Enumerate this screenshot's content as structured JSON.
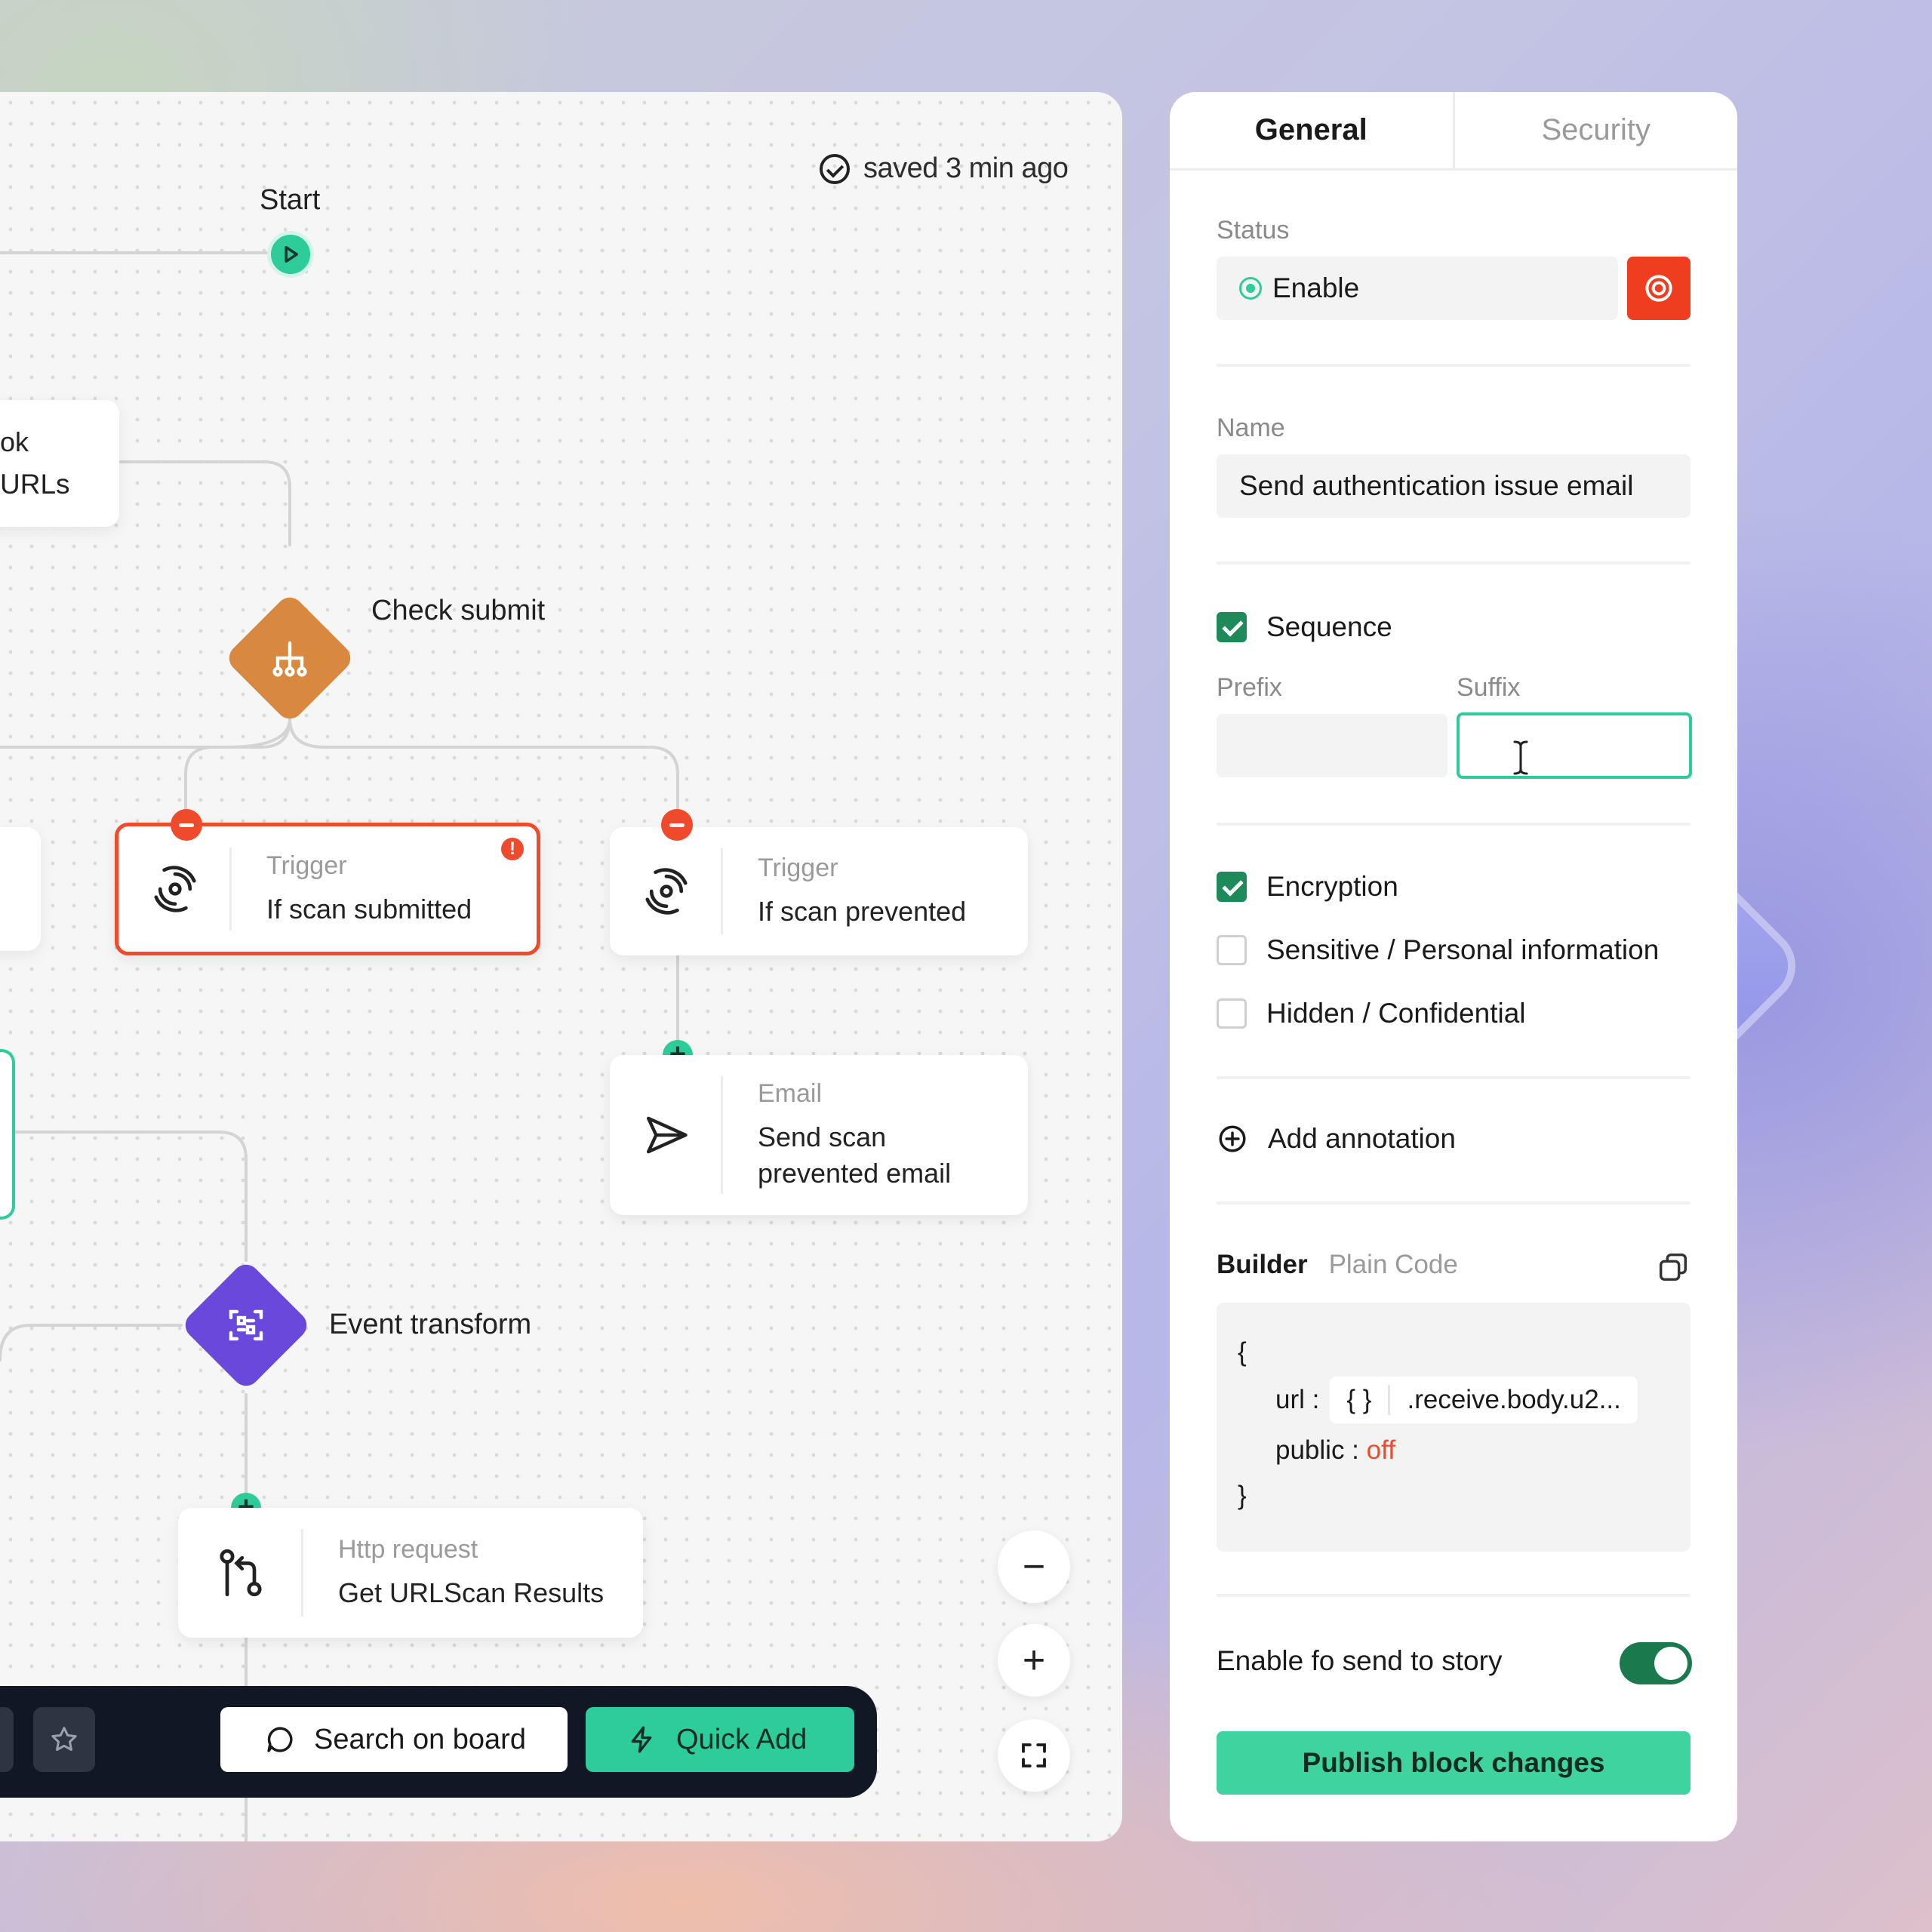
{
  "canvas": {
    "saved_status": "saved 3 min ago",
    "start_label": "Start",
    "partial_node": {
      "line1": "ok",
      "line2": "URLs"
    },
    "check_submit_label": "Check submit",
    "trigger_submitted": {
      "kind": "Trigger",
      "title": "If scan submitted"
    },
    "trigger_prevented": {
      "kind": "Trigger",
      "title": "If scan prevented"
    },
    "email_node": {
      "kind": "Email",
      "title_line1": "Send scan",
      "title_line2": "prevented email"
    },
    "event_transform_label": "Event transform",
    "http_node": {
      "kind": "Http request",
      "title": "Get URLScan Results"
    },
    "toolbar": {
      "search_label": "Search on board",
      "quick_add_label": "Quick Add"
    },
    "zoom": {
      "out": "−",
      "in": "+"
    }
  },
  "panel": {
    "tabs": [
      {
        "label": "General",
        "active": true
      },
      {
        "label": "Security",
        "active": false
      }
    ],
    "status": {
      "label": "Status",
      "value": "Enable"
    },
    "name": {
      "label": "Name",
      "value": "Send authentication issue email"
    },
    "sequence": {
      "label": "Sequence",
      "checked": true,
      "prefix_label": "Prefix",
      "suffix_label": "Suffix",
      "prefix_value": "",
      "suffix_value": ""
    },
    "options": [
      {
        "label": "Encryption",
        "checked": true
      },
      {
        "label": "Sensitive / Personal information",
        "checked": false
      },
      {
        "label": "Hidden / Confidential",
        "checked": false
      }
    ],
    "add_annotation": "Add annotation",
    "builder": {
      "tab_builder": "Builder",
      "tab_plain": "Plain Code",
      "open_brace": "{",
      "url_key": "url :",
      "url_pill_icon": "{ }",
      "url_value": ".receive.body.u2...",
      "public_key": "public :",
      "public_value": "off",
      "close_brace": "}"
    },
    "send_to_story": {
      "label": "Enable fo send to story",
      "on": true
    },
    "publish_label": "Publish block changes"
  },
  "colors": {
    "accent_green": "#2ecc9a",
    "error_red": "#ef4a2c",
    "diamond_orange": "#d8883f",
    "diamond_purple": "#6a48dc",
    "toolbar_dark": "#121726"
  }
}
